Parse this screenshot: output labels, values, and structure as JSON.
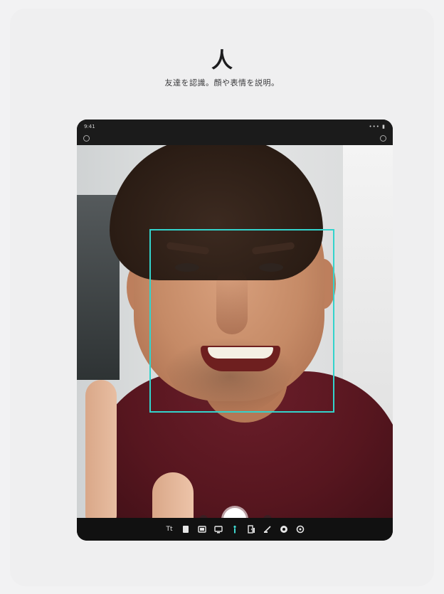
{
  "header": {
    "title": "人",
    "subtitle": "友達を認識。顔や表情を説明。"
  },
  "device": {
    "status_time": "9:41",
    "status_icons": "••• ▮"
  },
  "toolbar": {
    "items": [
      "text-icon",
      "document-icon",
      "scene-icon",
      "display-icon",
      "people-icon",
      "door-icon",
      "point-icon",
      "hand-icon",
      "settings-icon"
    ],
    "active_item": "people-icon",
    "text_icon_label": "Tt"
  },
  "colors": {
    "accent": "#33d3cc",
    "toolbar_bg": "#111111",
    "page_bg": "#f2f2f3"
  }
}
